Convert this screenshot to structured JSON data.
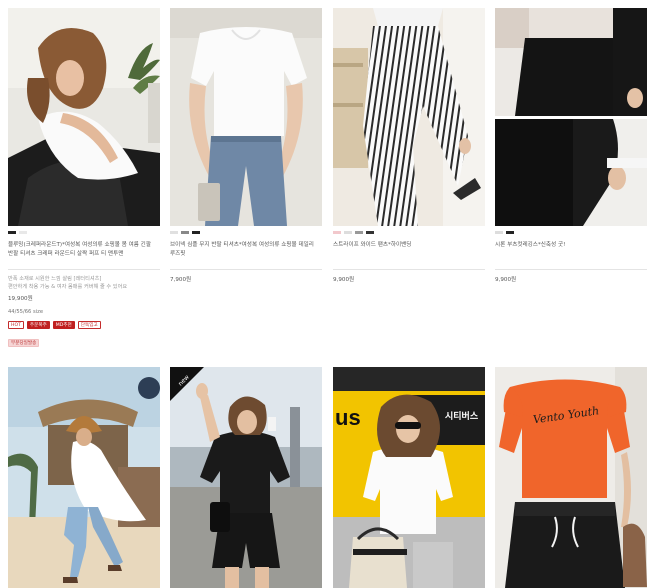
{
  "colors": {
    "accent": "#c42c2c",
    "accent_solid": "#c02020",
    "pink_badge_bg": "#f6d6d6",
    "text": "#555555",
    "muted": "#999999"
  },
  "products": [
    {
      "id": "p1",
      "swatches": [
        "#222222",
        "#e8e8e8"
      ],
      "name": "블루밍(크레퍼라운드T)*여성복 여성의류 쇼핑몰 봄 여름 긴팔 반팔 티셔츠 크레퍼 라운드티 살짝 퍼프 티 맨투맨",
      "summary_line1": "반폭 소재로 시원한 느낌 살림 [레터티셔츠]",
      "summary_line2": "편안하게 착용 가능 & 여자 몸매를 커버해 줄 수 있어요",
      "price": "19,900원",
      "sizes": "44/55/66 size",
      "badges": [
        "HOT",
        "주문폭주",
        "MD추천",
        "단독입고"
      ],
      "extra_badge": "부분당일발송"
    },
    {
      "id": "p2",
      "swatches": [
        "#e0e0e0",
        "#888888",
        "#222222"
      ],
      "name": "브이넥 심플 무지 반팔 티셔츠*여성복 여성의류 쇼핑몰 데일리 루즈핏",
      "price": "7,900원"
    },
    {
      "id": "p3",
      "swatches": [
        "#f2c8cc",
        "#dddddd",
        "#999999",
        "#333333"
      ],
      "name": "스트라이프 와이드 팬츠*하이밴딩",
      "price": "9,900원"
    },
    {
      "id": "p4",
      "swatches": [
        "#dddddd",
        "#222222"
      ],
      "name": "시론 부츠컷레깅스*신축성 굿!",
      "price": "9,900원"
    },
    {
      "id": "p5"
    },
    {
      "id": "p6",
      "photo_badge": "new"
    },
    {
      "id": "p7",
      "sign_text": "시티버스",
      "bus_text": "us"
    },
    {
      "id": "p8",
      "shirt_text": "Vento Youth"
    }
  ]
}
